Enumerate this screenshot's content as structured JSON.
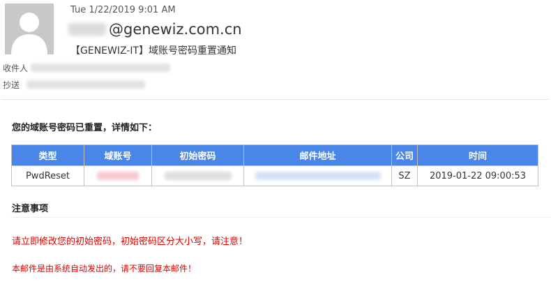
{
  "header": {
    "date": "Tue 1/22/2019 9:01 AM",
    "from_domain": "@genewiz.com.cn",
    "subject": "【GENEWIZ-IT】域账号密码重置通知",
    "to_label": "收件人",
    "cc_label": "抄送"
  },
  "body": {
    "notice": "您的域账号密码已重置，详情如下：",
    "table": {
      "headers": [
        "类型",
        "域账号",
        "初始密码",
        "邮件地址",
        "公司",
        "时间"
      ],
      "row": {
        "type": "PwdReset",
        "company": "SZ",
        "time": "2019-01-22 09:00:53"
      }
    },
    "section_title": "注意事项",
    "warning1": "请立即修改您的初始密码，初始密码区分大小写，请注意！",
    "warning2": "本邮件是由系统自动发出的，请不要回复本邮件！"
  },
  "colors": {
    "table_header_bg": "#4a86e8",
    "link_blue": "#3b6fd6",
    "warning_red": "#e00000"
  },
  "icons": {
    "avatar": "person-silhouette-icon"
  }
}
